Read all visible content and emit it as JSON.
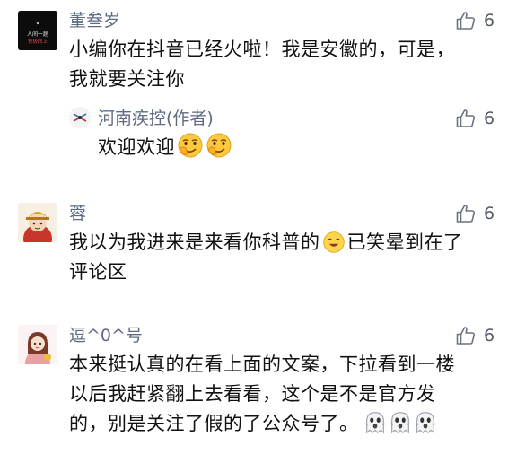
{
  "comments": [
    {
      "username": "董叁岁",
      "avatar_text": [
        "人间一趟",
        "积极向上"
      ],
      "line1": "小编你在抖音已经火啦！我是安徽的，可是，",
      "line2": "我就要关注你",
      "likes": "6",
      "reply": {
        "username": "河南疾控(作者)",
        "text": "欢迎欢迎",
        "likes": "6"
      }
    },
    {
      "username": "蓉",
      "line1": "我以为我进来是来看你科普的",
      "line1_after": "已笑晕到在了",
      "line2": "评论区",
      "likes": "6"
    },
    {
      "username": "逗^0^号",
      "line1": "本来挺认真的在看上面的文案，下拉看到一楼",
      "line2": "以后我赶紧翻上去看看，这个是不是官方发",
      "line3": "的，别是关注了假的了公众号了。",
      "likes": "6"
    }
  ],
  "icons": {
    "like": "thumbs-up-outline-icon",
    "emoji_smirk": "smirk-emoji-icon",
    "emoji_laugh": "laughing-emoji-icon",
    "emoji_ghost": "ghost-emoji-icon"
  },
  "colors": {
    "username": "#5f6b85",
    "text": "#111111",
    "like_icon": "#6b7280"
  }
}
